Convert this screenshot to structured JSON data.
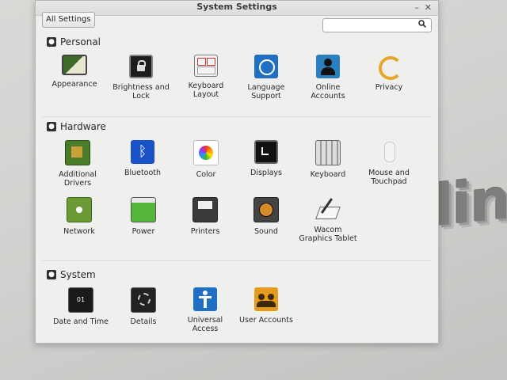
{
  "window": {
    "title": "System Settings"
  },
  "toolbar": {
    "all_settings_label": "All Settings",
    "search_value": "",
    "search_placeholder": ""
  },
  "sections": {
    "personal": {
      "label": "Personal",
      "items": [
        {
          "label": "Appearance"
        },
        {
          "label": "Brightness and Lock"
        },
        {
          "label": "Keyboard Layout"
        },
        {
          "label": "Language Support"
        },
        {
          "label": "Online Accounts"
        },
        {
          "label": "Privacy"
        }
      ]
    },
    "hardware": {
      "label": "Hardware",
      "items": [
        {
          "label": "Additional Drivers"
        },
        {
          "label": "Bluetooth"
        },
        {
          "label": "Color"
        },
        {
          "label": "Displays"
        },
        {
          "label": "Keyboard"
        },
        {
          "label": "Mouse and Touchpad"
        },
        {
          "label": "Network"
        },
        {
          "label": "Power"
        },
        {
          "label": "Printers"
        },
        {
          "label": "Sound"
        },
        {
          "label": "Wacom Graphics Tablet"
        }
      ]
    },
    "system": {
      "label": "System",
      "items": [
        {
          "label": "Date and Time"
        },
        {
          "label": "Details"
        },
        {
          "label": "Universal Access"
        },
        {
          "label": "User Accounts"
        }
      ]
    }
  },
  "background": {
    "logo_text": "linux"
  }
}
